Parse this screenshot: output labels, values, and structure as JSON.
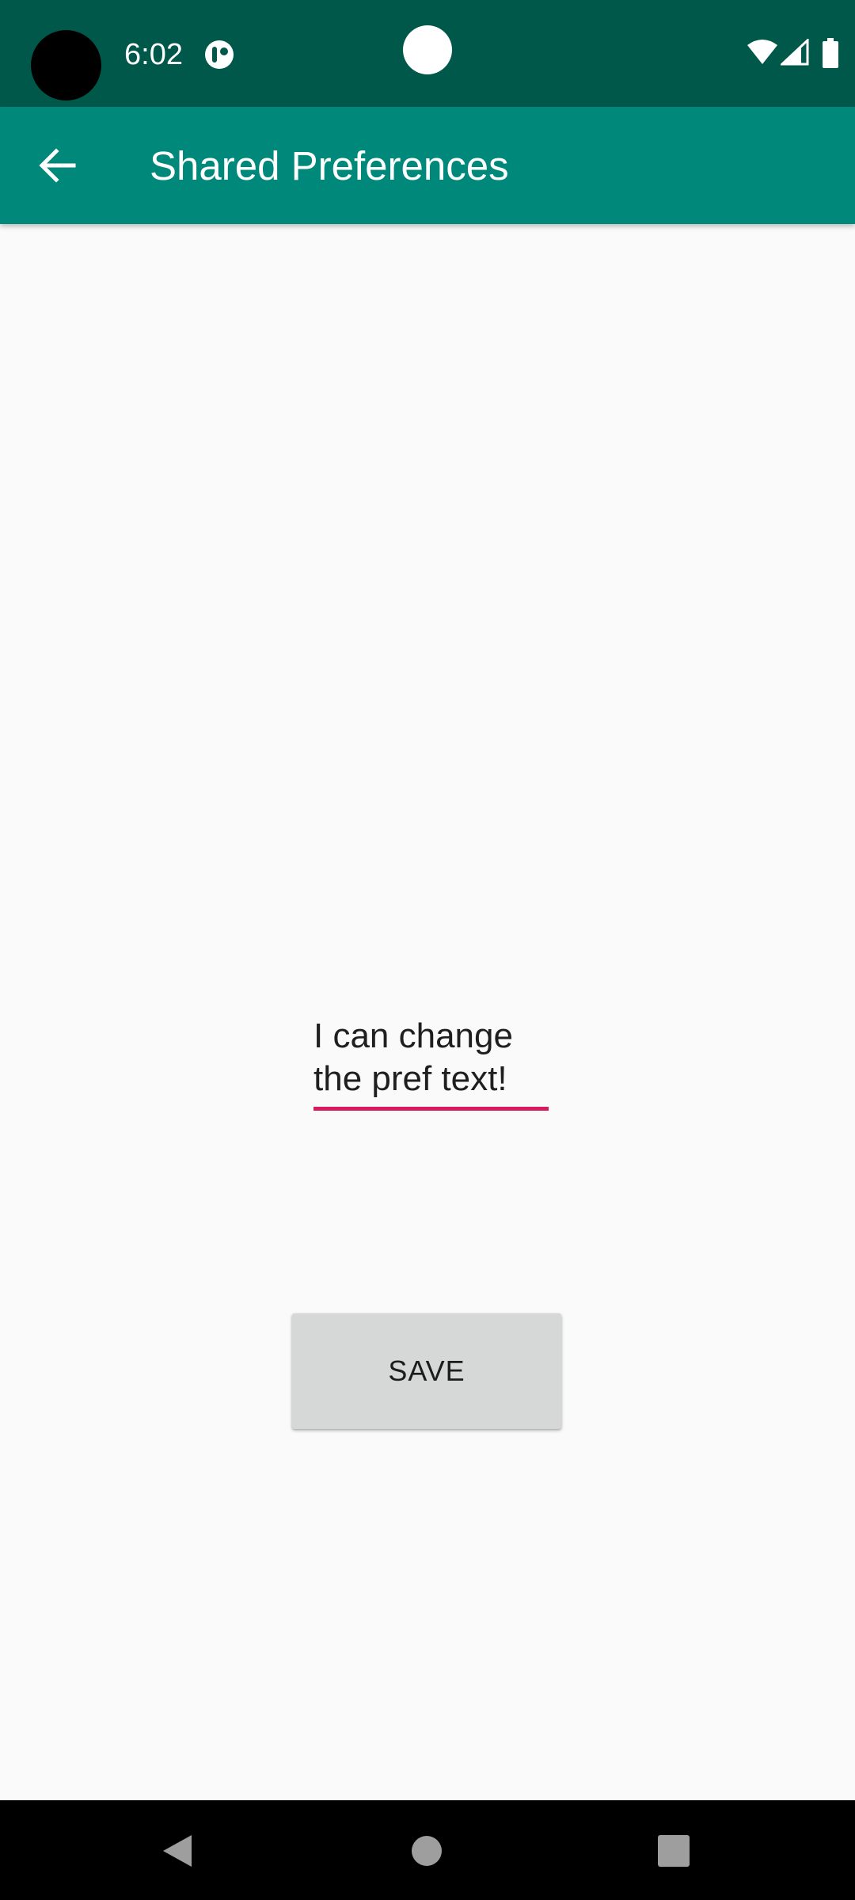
{
  "status_bar": {
    "time": "6:02",
    "icons": [
      "notification-icon",
      "wifi-icon",
      "signal-icon",
      "battery-icon"
    ],
    "background": "#00584b"
  },
  "app_bar": {
    "title": "Shared Preferences",
    "back_icon": "arrow-left-icon",
    "background": "#00897b"
  },
  "main": {
    "pref_text_value": "I can change the pref text!",
    "accent_color": "#d81b60",
    "save_label": "SAVE"
  },
  "nav_bar": {
    "buttons": [
      "back-triangle-icon",
      "home-circle-icon",
      "recents-square-icon"
    ]
  }
}
